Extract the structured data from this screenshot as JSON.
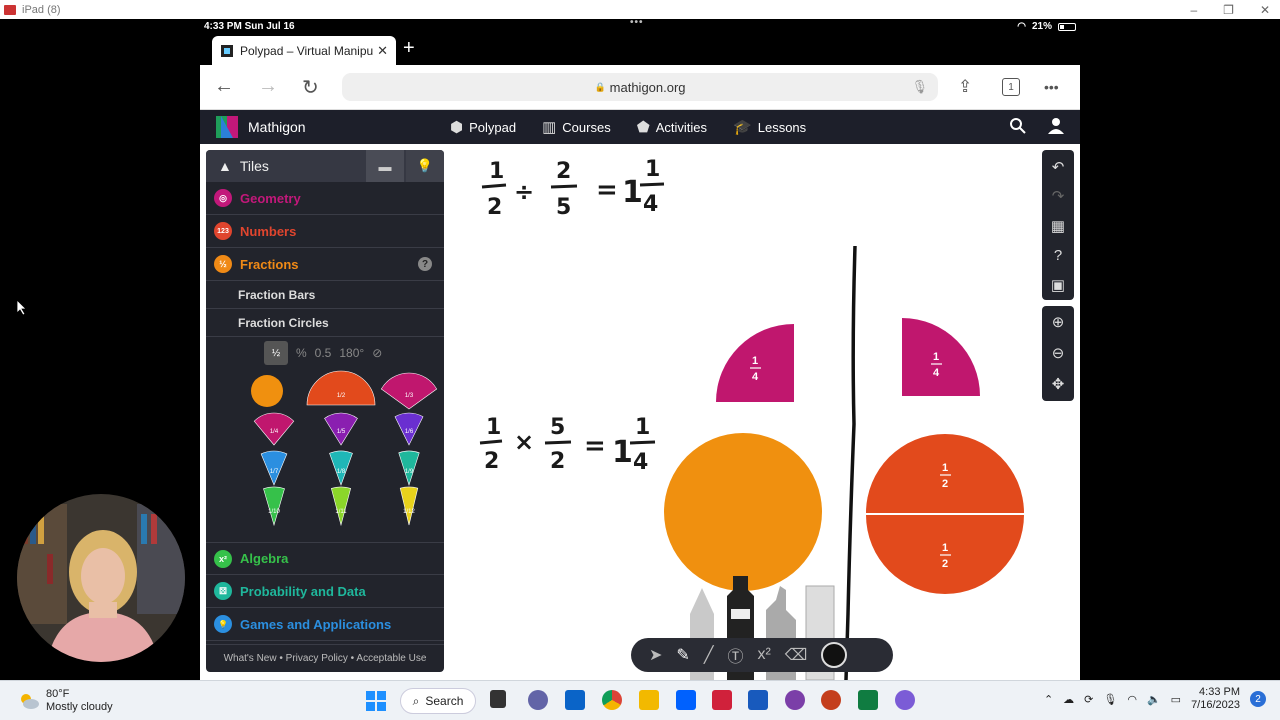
{
  "window": {
    "title": "iPad (8)",
    "min": "–",
    "max": "❐",
    "close": "✕"
  },
  "status": {
    "time": "4:33 PM  Sun Jul 16",
    "dots": "•••",
    "battery": "21%"
  },
  "browser": {
    "tab_title": "Polypad – Virtual Manipu",
    "tab_close": "✕",
    "new_tab": "+",
    "url": "mathigon.org",
    "back": "←",
    "forward": "→",
    "reload": "↻",
    "tabs_count": "1",
    "more": "•••"
  },
  "site": {
    "brand": "Mathigon",
    "nav": [
      {
        "label": "Polypad",
        "icon": "polypad-icon"
      },
      {
        "label": "Courses",
        "icon": "courses-icon"
      },
      {
        "label": "Activities",
        "icon": "activities-icon"
      },
      {
        "label": "Lessons",
        "icon": "lessons-icon"
      }
    ]
  },
  "sidebar": {
    "header": "Tiles",
    "categories_top": [
      {
        "label": "Geometry",
        "color": "#c2187a",
        "icon_glyph": "◎"
      },
      {
        "label": "Numbers",
        "color": "#e0452e",
        "icon_glyph": "123"
      },
      {
        "label": "Fractions",
        "color": "#f08a16",
        "icon_glyph": "½"
      }
    ],
    "help": "?",
    "subitems": [
      "Fraction Bars",
      "Fraction Circles"
    ],
    "formats": [
      "%",
      "0.5",
      "180°"
    ],
    "format_selected": "½",
    "categories_bottom": [
      {
        "label": "Algebra",
        "color": "#36c14a",
        "icon_glyph": "x²"
      },
      {
        "label": "Probability and Data",
        "color": "#1fb79c",
        "icon_glyph": "⚄"
      },
      {
        "label": "Games and Applications",
        "color": "#2b8fe0",
        "icon_glyph": "💡"
      }
    ],
    "footer": "What's New • Privacy Policy • Acceptable Use",
    "tile_labels": [
      "1/2",
      "1/3",
      "1/4",
      "1/5",
      "1/6",
      "1/7",
      "1/8",
      "1/9",
      "1/10",
      "1/11",
      "1/12"
    ]
  },
  "canvas": {
    "eq1": {
      "a_num": "1",
      "a_den": "2",
      "op": "÷",
      "b_num": "2",
      "b_den": "5",
      "eq": "=",
      "whole": "1",
      "r_num": "1",
      "r_den": "4"
    },
    "eq2": {
      "a_num": "1",
      "a_den": "2",
      "op": "×",
      "b_num": "5",
      "b_den": "2",
      "eq": "=",
      "whole": "1",
      "r_num": "1",
      "r_den": "4"
    },
    "pieces": {
      "left_quarter": {
        "num": "1",
        "den": "4",
        "color": "#c0176e"
      },
      "right_quarter": {
        "num": "1",
        "den": "4",
        "color": "#c0176e"
      },
      "left_whole": {
        "color": "#f0900f"
      },
      "right_half_top": {
        "num": "1",
        "den": "2",
        "color": "#e24a1c"
      },
      "right_half_bottom": {
        "num": "1",
        "den": "2",
        "color": "#e24a1c"
      }
    }
  },
  "taskbar": {
    "weather_temp": "80°F",
    "weather_desc": "Mostly cloudy",
    "search": "Search",
    "time": "4:33 PM",
    "date": "7/16/2023",
    "notifications": "2"
  }
}
